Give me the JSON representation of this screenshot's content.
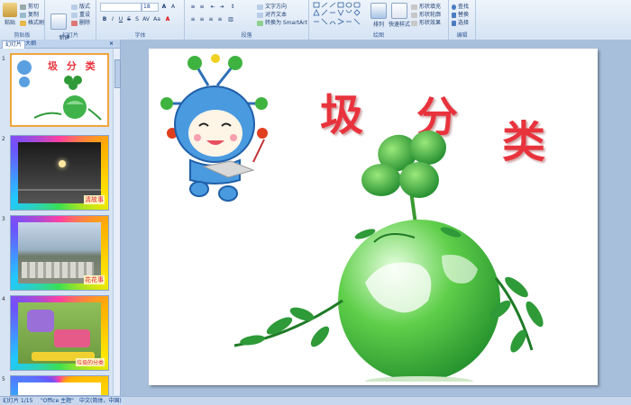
{
  "ribbon": {
    "clipboard": {
      "label": "剪贴板",
      "paste": "粘贴",
      "cut": "剪切",
      "copy": "复制",
      "format_painter": "格式刷"
    },
    "slides": {
      "label": "幻灯片",
      "new_slide": "新建\n幻灯片",
      "layout": "版式",
      "reset": "重设",
      "delete": "删除"
    },
    "font": {
      "label": "字体",
      "font_name": "",
      "font_size": "18"
    },
    "paragraph": {
      "label": "段落",
      "text_direction": "文字方向",
      "align_text": "对齐文本",
      "smartart": "转换为 SmartArt"
    },
    "drawing": {
      "label": "绘图",
      "arrange": "排列",
      "quick_styles": "快速样式",
      "fill": "形状填充",
      "outline": "形状轮廓",
      "effects": "形状效果"
    },
    "editing": {
      "label": "编辑",
      "find": "查找",
      "replace": "替换",
      "select": "选择"
    }
  },
  "pane": {
    "tab_slides": "幻灯片",
    "tab_outline": "大纲",
    "thumbs": [
      {
        "num": "1",
        "title": "圾 分 类",
        "caption": ""
      },
      {
        "num": "2",
        "title": "",
        "caption": "清故事"
      },
      {
        "num": "3",
        "title": "",
        "caption": "花花事"
      },
      {
        "num": "4",
        "title": "",
        "caption": "垃圾的分类"
      },
      {
        "num": "5",
        "title": "",
        "caption": ""
      }
    ]
  },
  "slide": {
    "title_chars": [
      "圾",
      "分",
      "类"
    ]
  },
  "status": {
    "slide_info": "幻灯片 1/15",
    "theme": "\"Office 主题\"",
    "language": "中文(简体，中国)"
  }
}
